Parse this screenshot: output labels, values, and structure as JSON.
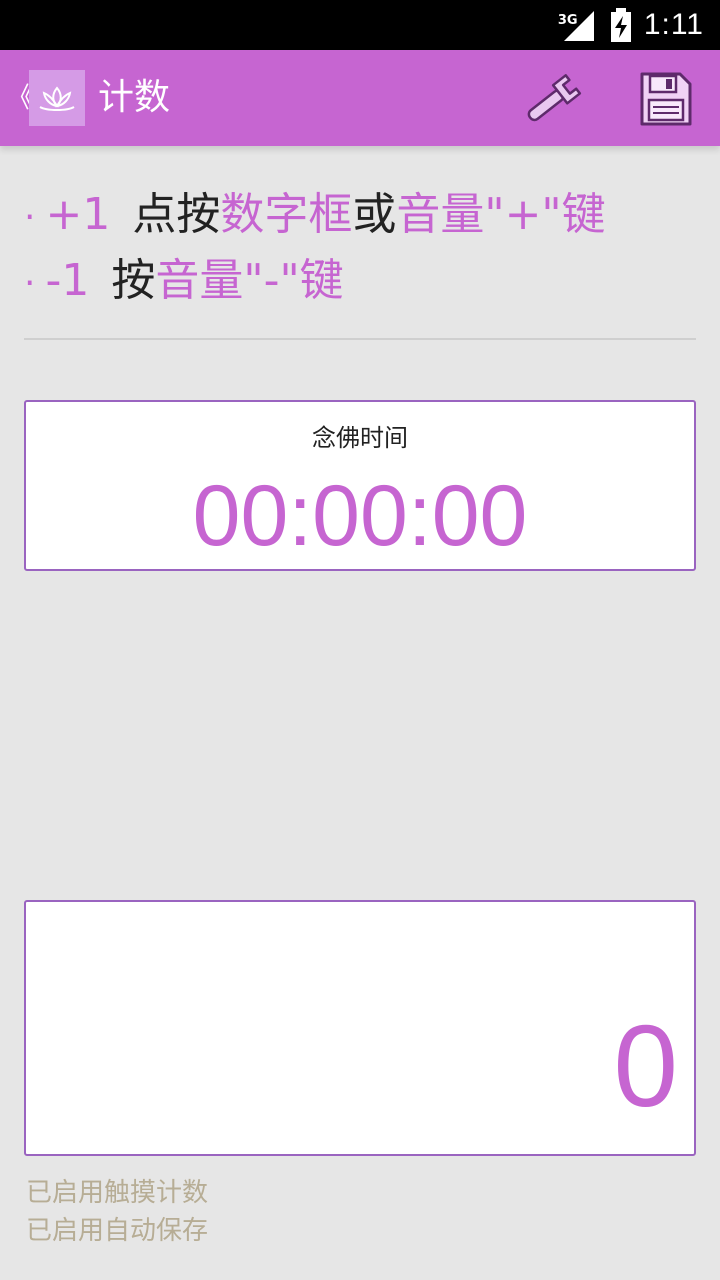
{
  "status_bar": {
    "network": "3G",
    "time": "1:11"
  },
  "action_bar": {
    "back_glyph": "《",
    "logo_icon": "lotus-icon",
    "title": "计数",
    "settings_icon": "wrench-icon",
    "save_icon": "floppy-disk-icon"
  },
  "instructions": {
    "line1": {
      "bullet": "·",
      "key": "+1",
      "text_a": "点按",
      "hl_a": "数字框",
      "text_b": "或",
      "hl_b": "音量",
      "text_c": "\"+\"键"
    },
    "line2": {
      "bullet": "·",
      "key": "-1",
      "text_a": "按",
      "hl_a": "音量",
      "text_c": "\"-\"键"
    }
  },
  "timer": {
    "label": "念佛时间",
    "value": "00:00:00"
  },
  "counter": {
    "value": "0"
  },
  "notes": {
    "touch": "已启用触摸计数",
    "autosave": "已启用自动保存"
  },
  "colors": {
    "accent": "#c665d1",
    "border": "#9a64c0",
    "note": "#b7ad95",
    "background": "#e6e6e6"
  }
}
